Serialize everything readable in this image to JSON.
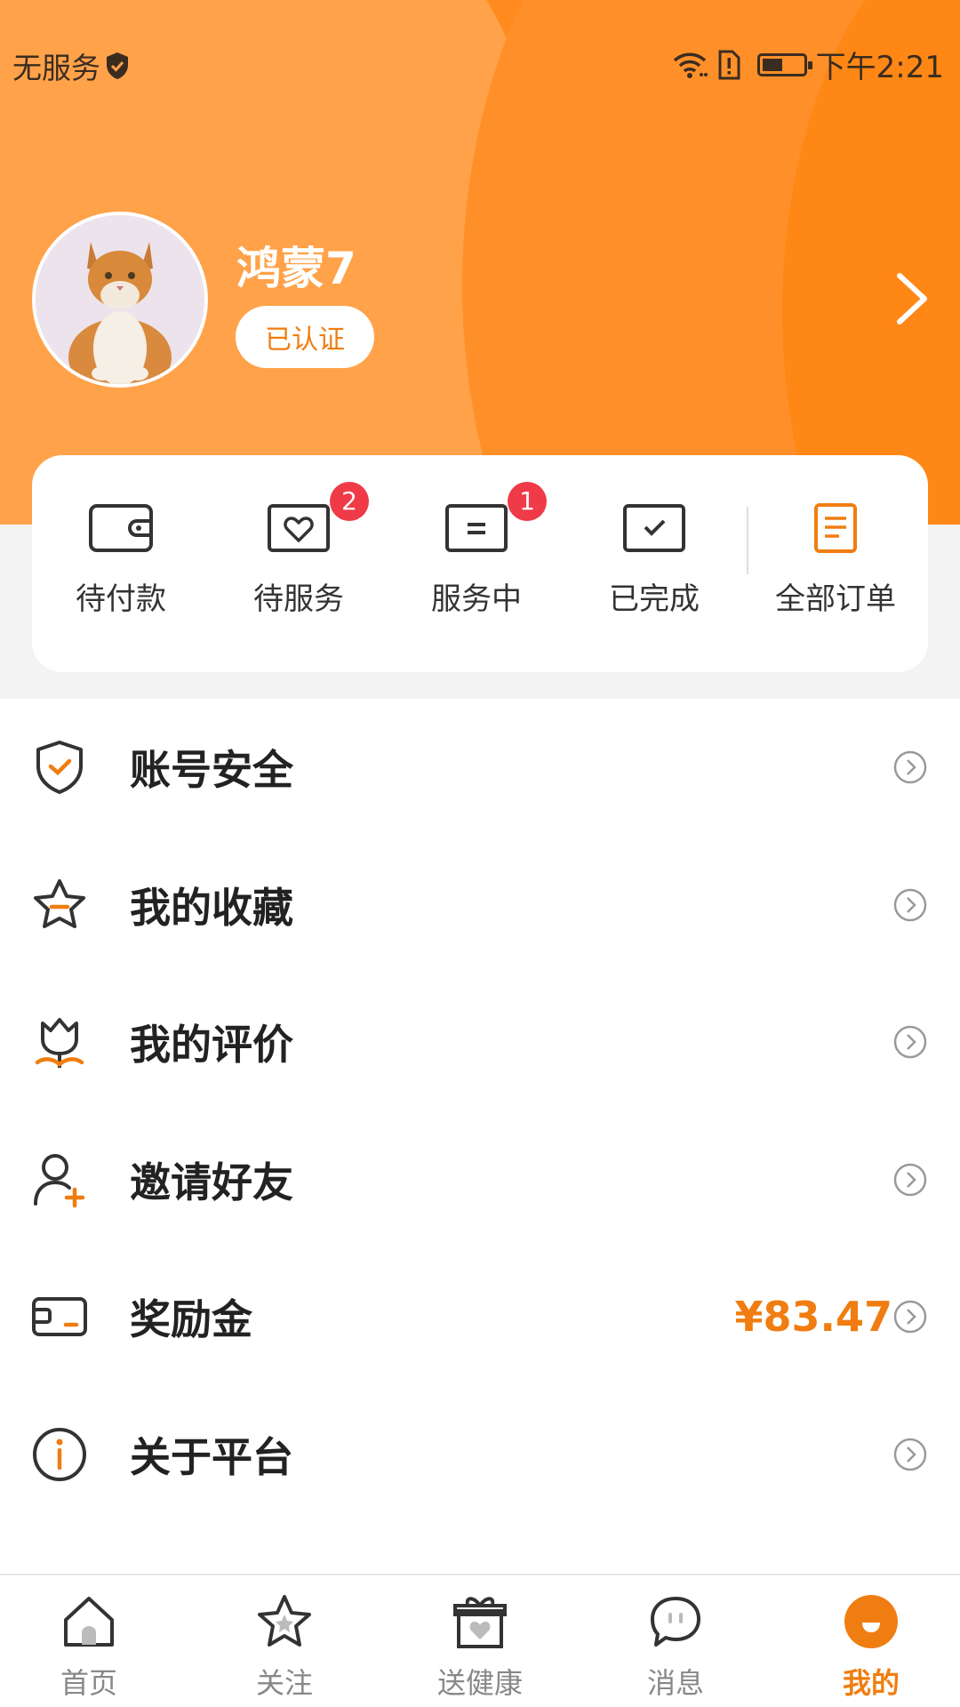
{
  "status_bar": {
    "carrier": "无服务",
    "time": "下午2:21"
  },
  "profile": {
    "username": "鸿蒙7",
    "badge": "已认证"
  },
  "orders": {
    "items": [
      {
        "label": "待付款",
        "icon": "wallet-icon",
        "badge": ""
      },
      {
        "label": "待服务",
        "icon": "heart-card-icon",
        "badge": "2"
      },
      {
        "label": "服务中",
        "icon": "card-icon",
        "badge": "1"
      },
      {
        "label": "已完成",
        "icon": "check-card-icon",
        "badge": ""
      },
      {
        "label": "全部订单",
        "icon": "document-icon",
        "badge": ""
      }
    ]
  },
  "menu": {
    "items": [
      {
        "label": "账号安全",
        "icon": "shield-check-icon",
        "value": ""
      },
      {
        "label": "我的收藏",
        "icon": "star-icon",
        "value": ""
      },
      {
        "label": "我的评价",
        "icon": "flower-icon",
        "value": ""
      },
      {
        "label": "邀请好友",
        "icon": "add-user-icon",
        "value": ""
      },
      {
        "label": "奖励金",
        "icon": "wallet-card-icon",
        "value": "¥83.47"
      },
      {
        "label": "关于平台",
        "icon": "info-icon",
        "value": ""
      }
    ]
  },
  "tabbar": {
    "items": [
      {
        "label": "首页",
        "icon": "home-icon"
      },
      {
        "label": "关注",
        "icon": "star-icon"
      },
      {
        "label": "送健康",
        "icon": "gift-icon"
      },
      {
        "label": "消息",
        "icon": "chat-icon"
      },
      {
        "label": "我的",
        "icon": "profile-icon"
      }
    ],
    "active": "我的"
  },
  "colors": {
    "accent": "#f07d11",
    "header": "#ff8b1e",
    "badge": "#ef3a48"
  }
}
